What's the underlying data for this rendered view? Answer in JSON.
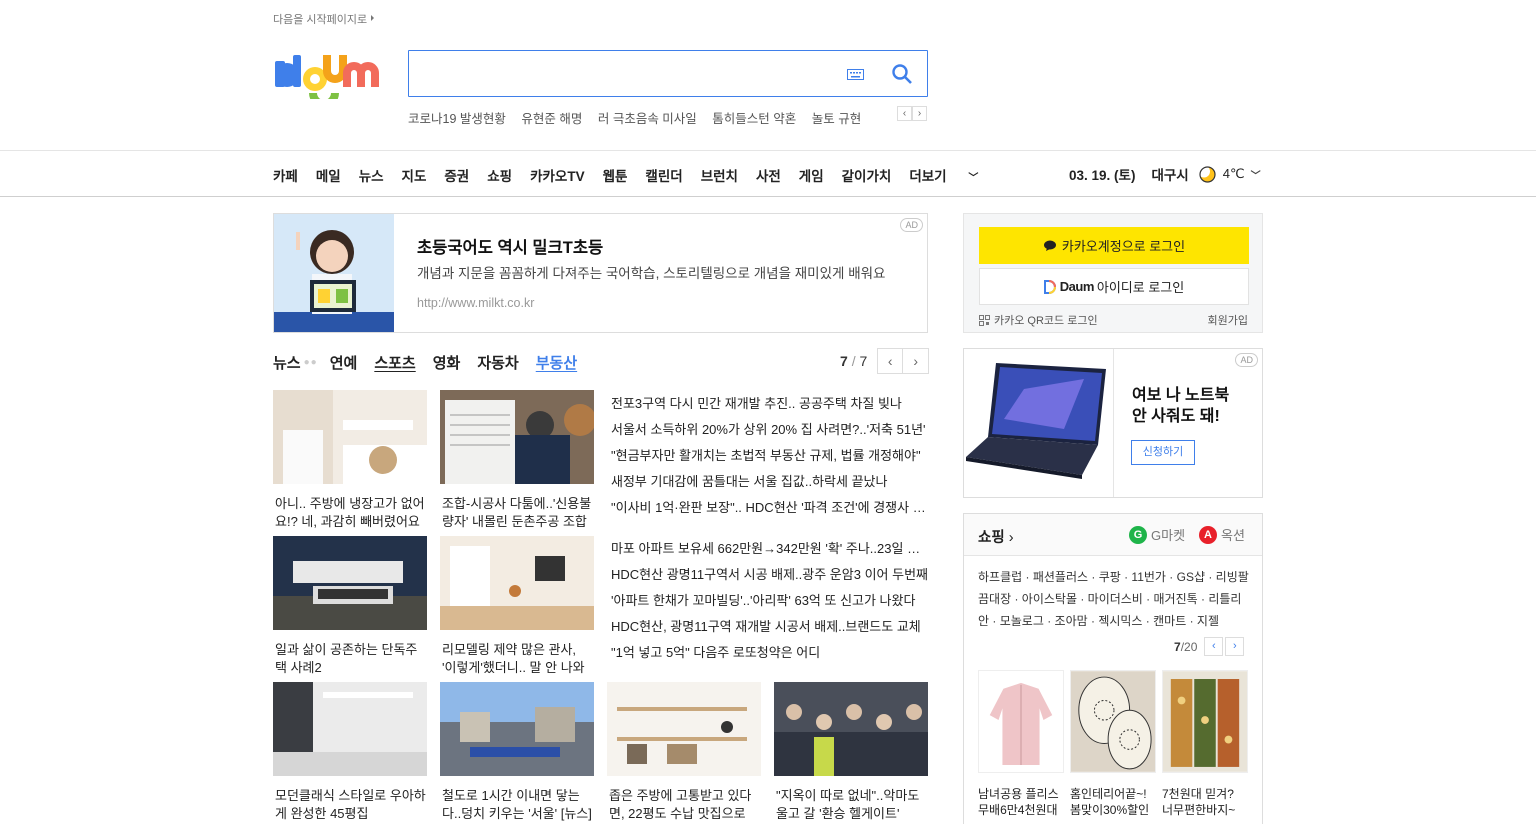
{
  "top_link": "다음을 시작페이지로",
  "search": {
    "placeholder": ""
  },
  "trending": [
    "코로나19 발생현황",
    "유현준 해명",
    "러 극초음속 미사일",
    "톰히들스턴 약혼",
    "놀토 규현"
  ],
  "gnb": {
    "menu": [
      "카페",
      "메일",
      "뉴스",
      "지도",
      "증권",
      "쇼핑",
      "카카오TV",
      "웹툰",
      "캘린더",
      "브런치",
      "사전",
      "게임",
      "같이가치",
      "더보기"
    ],
    "date": "03. 19. (토)",
    "city": "대구시",
    "temp": "4℃"
  },
  "ad_banner": {
    "title": "초등국어도 역시 밀크T초등",
    "desc": "개념과 지문을 꼼꼼하게 다져주는 국어학습, 스토리텔링으로 개념을 재미있게 배워요",
    "url": "http://www.milkt.co.kr",
    "badge": "AD"
  },
  "news_tabs": [
    "뉴스",
    "연예",
    "스포츠",
    "영화",
    "자동차",
    "부동산"
  ],
  "news_pager": {
    "current": "7",
    "total": "7"
  },
  "thumbs": [
    "아니.. 주방에 냉장고가 없어요!? 네, 과감히 빼버렸어요",
    "조합-시공사 다툼에..'신용불량자' 내몰린 둔촌주공 조합원",
    "일과 삶이 공존하는 단독주택 사례2",
    "리모델링 제약 많은 관사, '이렇게'했더니.. 말 안 나와",
    "모던클래식 스타일로 우아하게 완성한 45평집",
    "철도로 1시간 이내면 닿는다..덩치 키우는 '서울' [뉴스]",
    "좁은 주방에 고통받고 있다면, 22평도 수납 맛집으로",
    "\"지옥이 따로 없네\"..악마도 울고 갈 '환승 헬게이트'"
  ],
  "headlines_1": [
    "전포3구역 다시 민간 재개발 추진.. 공공주택 차질 빚나",
    "서울서 소득하위 20%가 상위 20% 집 사려면?..'저축 51년'",
    "\"현금부자만 활개치는 초법적 부동산 규제, 법률 개정해야\"",
    "새정부 기대감에 꿈틀대는 서울 집값..하락세 끝났나",
    "\"이사비 1억·완판 보장\".. HDC현산 '파격 조건'에 경쟁사 반발"
  ],
  "headlines_2": [
    "마포 아파트 보유세 662만원→342만원 '확' 주나..23일 발표",
    "HDC현산 광명11구역서 시공 배제..광주 운암3 이어 두번째",
    "'아파트 한채가 꼬마빌딩'..'아리팍' 63억 또 신고가 나왔다",
    "HDC현산, 광명11구역 재개발 시공서 배제..브랜드도 교체",
    "\"1억 넣고 5억\" 다음주 로또청약은 어디"
  ],
  "login": {
    "kakao": "카카오계정으로 로그인",
    "daum_logo": "Daum",
    "daum": "아이디로 로그인",
    "qr": "카카오 QR코드 로그인",
    "signup": "회원가입"
  },
  "ad_right": {
    "title_1": "여보 나 노트북",
    "title_2": "안 사줘도 돼!",
    "cta": "신청하기",
    "badge": "AD"
  },
  "shopping": {
    "title": "쇼핑",
    "gmarket": "G마켓",
    "auction": "옥션",
    "links": "하프클럽 · 패션플러스 · 쿠팡 · 11번가 · GS샵 · 리빙팔끔대장 · 아이스탁몰 · 마이더스비 · 매거진톡 · 리틀리안 · 모놀로그 · 조아맘 · 젝시믹스 · 캔마트 · 지젤",
    "pager_current": "7",
    "pager_total": "/20",
    "products": [
      {
        "l1": "남녀공용 플리스",
        "l2": "무배6만4천원대"
      },
      {
        "l1": "홈인테리어끝~!",
        "l2": "봄맞이30%할인"
      },
      {
        "l1": "7천원대 믿겨?",
        "l2": "너무편한바지~"
      }
    ]
  },
  "colors": {
    "accent": "#3f7fea",
    "kakao": "#fee500"
  }
}
